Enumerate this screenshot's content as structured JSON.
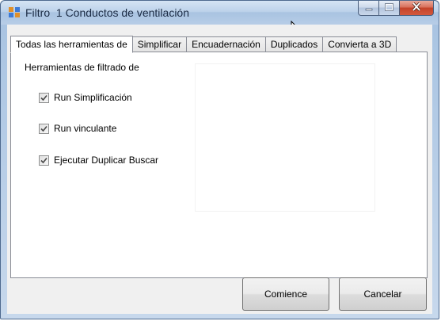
{
  "window": {
    "title": "Filtro  1 Conductos de ventilación"
  },
  "caption_buttons": {
    "minimize_icon": "minimize-icon",
    "maximize_icon": "maximize-icon",
    "close_icon": "close-icon"
  },
  "tabs": [
    {
      "label": "Todas las herramientas de",
      "active": true
    },
    {
      "label": "Simplificar",
      "active": false
    },
    {
      "label": "Encuadernación",
      "active": false
    },
    {
      "label": "Duplicados",
      "active": false
    },
    {
      "label": "Convierta a 3D",
      "active": false
    }
  ],
  "panel": {
    "group_label": "Herramientas de filtrado de",
    "checkboxes": [
      {
        "label": "Run Simplificación",
        "checked": true
      },
      {
        "label": "Run vinculante",
        "checked": true
      },
      {
        "label": "Ejecutar Duplicar Buscar",
        "checked": true
      }
    ]
  },
  "buttons": {
    "start_label": "Comience",
    "cancel_label": "Cancelar"
  },
  "colors": {
    "titlebar": "#bcd2ea",
    "close_button": "#c4432a",
    "dialog_bg": "#f0f0f0"
  }
}
